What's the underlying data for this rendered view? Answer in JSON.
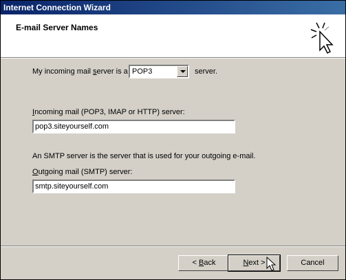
{
  "window": {
    "title": "Internet Connection Wizard"
  },
  "header": {
    "title": "E-mail Server Names",
    "icon": "wizard-sparkle-cursor-icon"
  },
  "server_type": {
    "prefix_label_pre": "My incoming mail ",
    "prefix_label_key": "s",
    "prefix_label_post": "erver is a",
    "selected": "POP3",
    "suffix_label": "server."
  },
  "incoming": {
    "label_key": "I",
    "label_rest": "ncoming mail (POP3, IMAP or HTTP) server:",
    "value": "pop3.siteyourself.com"
  },
  "smtp_note": "An SMTP server is the server that is used for your outgoing e-mail.",
  "outgoing": {
    "label_key": "O",
    "label_rest": "utgoing mail (SMTP) server:",
    "value": "smtp.siteyourself.com"
  },
  "buttons": {
    "back_pre": "< ",
    "back_key": "B",
    "back_rest": "ack",
    "next_key": "N",
    "next_rest": "ext >",
    "cancel": "Cancel"
  },
  "colors": {
    "titlebar_start": "#0a246a",
    "titlebar_end": "#3a6ea5",
    "face": "#d4d0c8"
  }
}
